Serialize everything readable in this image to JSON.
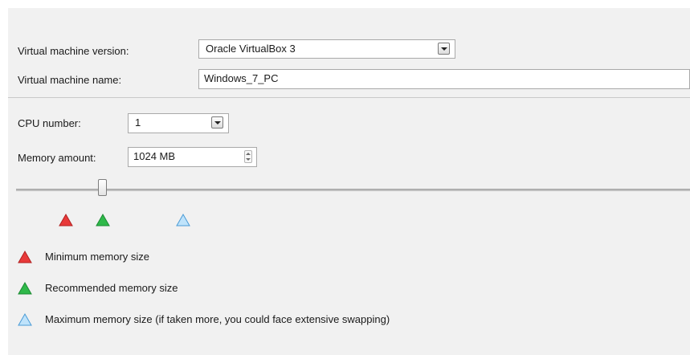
{
  "vm": {
    "version_label": "Virtual machine version:",
    "version_value": "Oracle VirtualBox 3",
    "name_label": "Virtual machine name:",
    "name_value": "Windows_7_PC"
  },
  "cpu": {
    "label": "CPU number:",
    "value": "1"
  },
  "memory": {
    "label": "Memory amount:",
    "value": "1024 MB"
  },
  "legend": {
    "min": "Minimum memory size",
    "recommended": "Recommended memory size",
    "max": "Maximum memory size (if taken more, you could face extensive swapping)"
  },
  "colors": {
    "min": "#e83a3a",
    "recommended": "#2fb94a",
    "max": "#6fb9ec"
  },
  "icons": {
    "min": "red-triangle-icon",
    "recommended": "green-triangle-icon",
    "max": "blue-triangle-icon"
  }
}
